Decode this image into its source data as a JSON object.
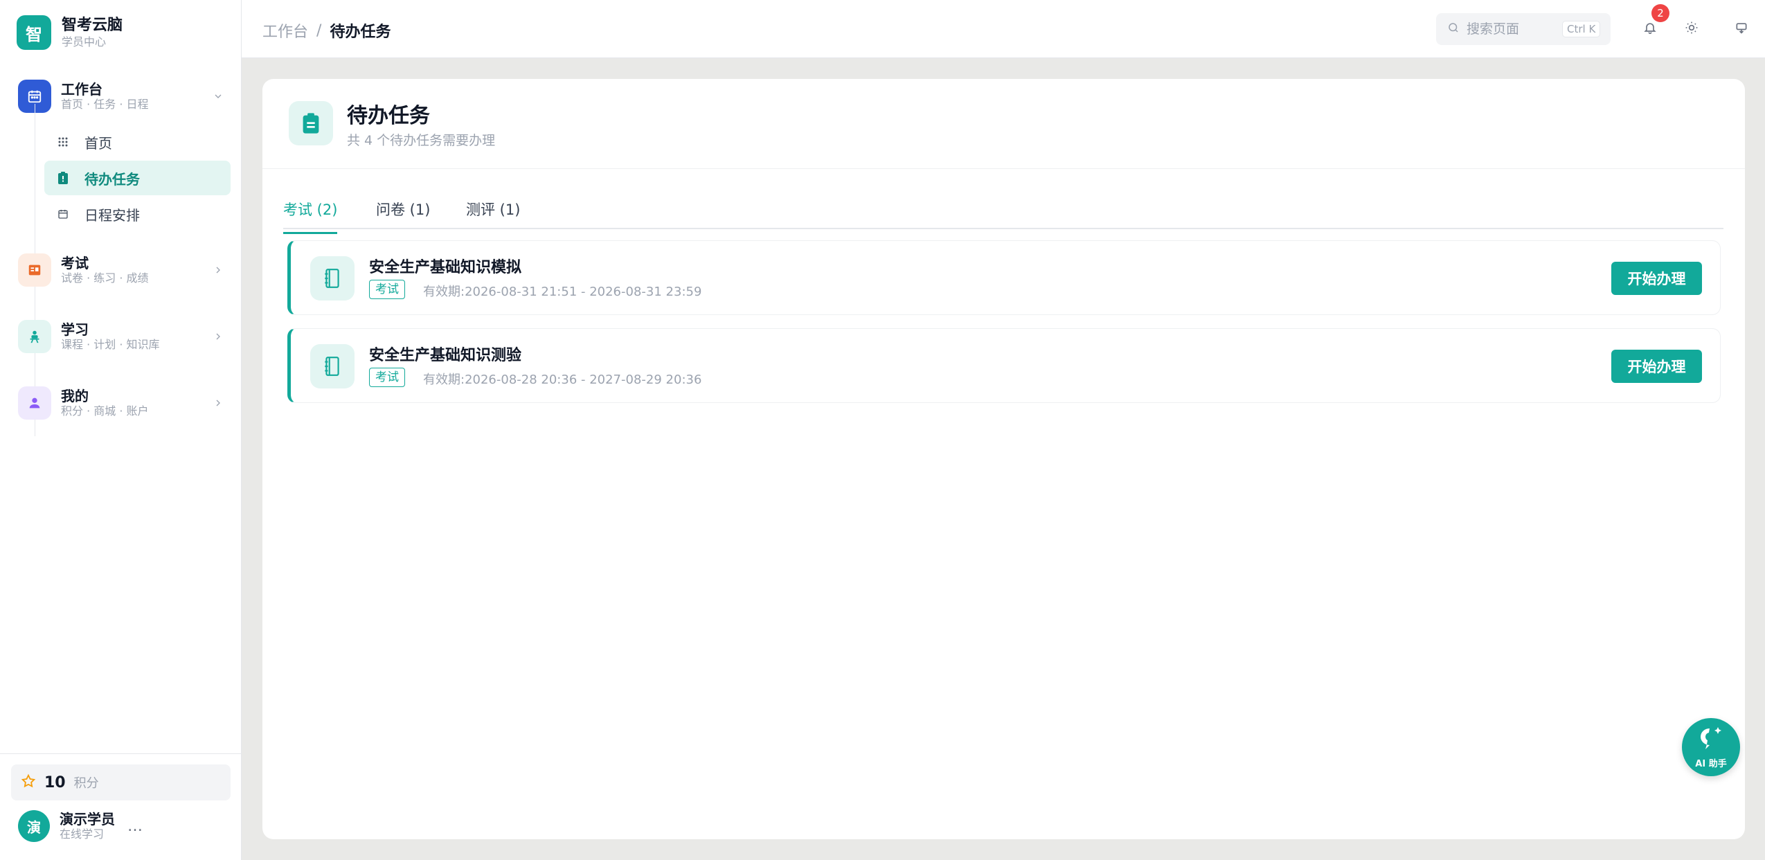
{
  "brand": {
    "logo_char": "智",
    "name": "智考云脑",
    "sub": "学员中心"
  },
  "sidebar": {
    "groups": [
      {
        "title": "工作台",
        "sub": "首页 · 任务 · 日程",
        "color": "#2f5bd6"
      },
      {
        "title": "考试",
        "sub": "试卷 · 练习 · 成绩",
        "color": "#ea6a2a"
      },
      {
        "title": "学习",
        "sub": "课程 · 计划 · 知识库",
        "color": "#12a99a"
      },
      {
        "title": "我的",
        "sub": "积分 · 商城 · 账户",
        "color": "#8b5cf6"
      }
    ],
    "items": [
      {
        "label": "首页"
      },
      {
        "label": "待办任务"
      },
      {
        "label": "日程安排"
      }
    ]
  },
  "points": {
    "value": "10",
    "label": "积分"
  },
  "user": {
    "avatar_char": "演",
    "name": "演示学员",
    "status": "在线学习",
    "more": "…"
  },
  "topbar": {
    "crumb_root": "工作台",
    "crumb_sep": "/",
    "crumb_current": "待办任务",
    "search_placeholder": "搜索页面",
    "search_shortcut": "Ctrl K",
    "notification_count": "2"
  },
  "page": {
    "title": "待办任务",
    "subtitle": "共 4 个待办任务需要办理"
  },
  "tabs": [
    {
      "label": "考试 (2)"
    },
    {
      "label": "问卷 (1)"
    },
    {
      "label": "测评 (1)"
    }
  ],
  "tasks": [
    {
      "title": "安全生产基础知识模拟",
      "tag": "考试",
      "period": "有效期:2026-08-31 21:51 - 2026-08-31 23:59",
      "action": "开始办理"
    },
    {
      "title": "安全生产基础知识测验",
      "tag": "考试",
      "period": "有效期:2026-08-28 20:36 - 2027-08-29 20:36",
      "action": "开始办理"
    }
  ],
  "ai": {
    "label": "AI 助手"
  },
  "colors": {
    "accent": "#12a99a",
    "accent_light": "#e3f5f2",
    "badge": "#ef4444"
  }
}
